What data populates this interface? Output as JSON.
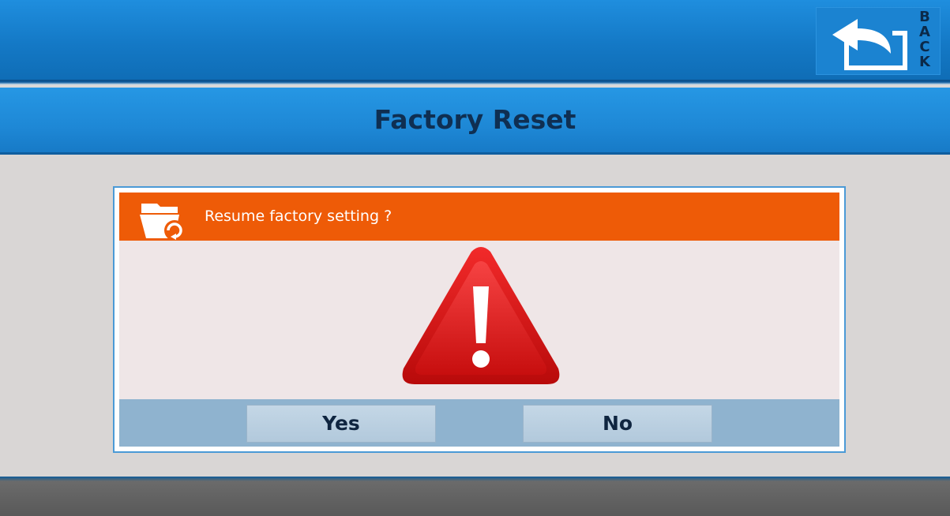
{
  "header": {
    "back_letters": [
      "B",
      "A",
      "C",
      "K"
    ]
  },
  "page": {
    "title": "Factory Reset"
  },
  "dialog": {
    "title": "Resume factory setting ?",
    "header_icon": "folder-refresh-icon",
    "warning_icon": "warning-triangle-icon",
    "yes_label": "Yes",
    "no_label": "No"
  },
  "colors": {
    "header_blue": "#1479c6",
    "dialog_header_orange": "#ee5b07",
    "warning_red": "#d81414",
    "button_bar": "#8fb3cf"
  }
}
